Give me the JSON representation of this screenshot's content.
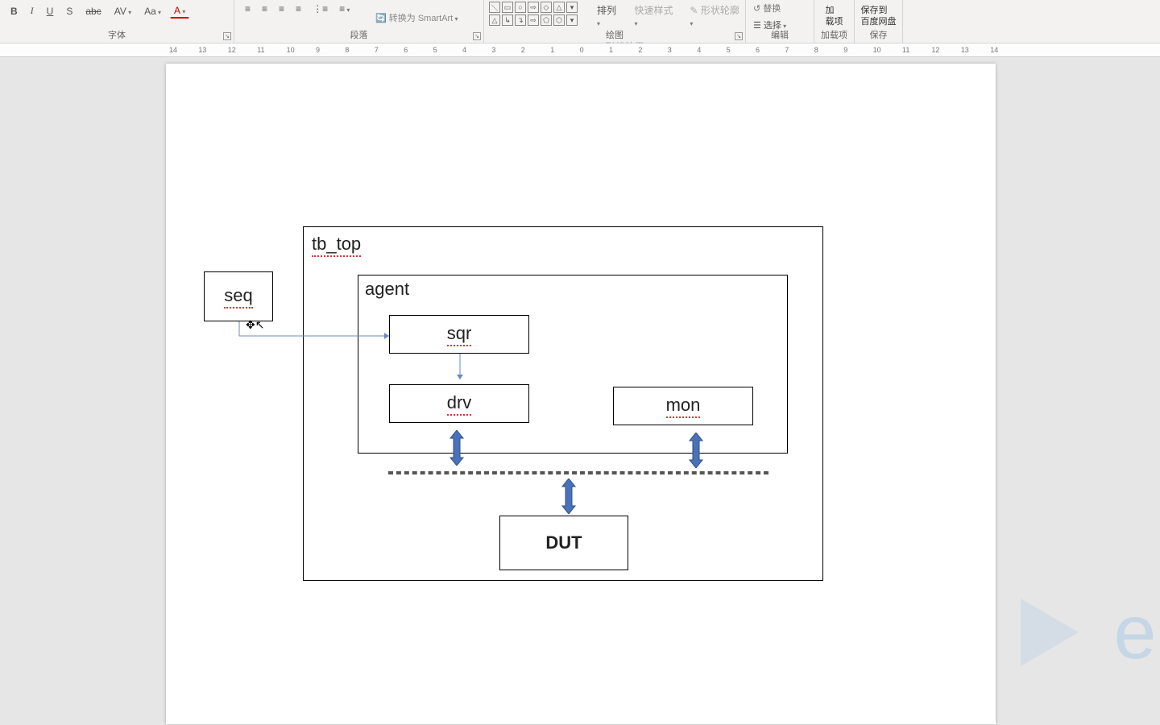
{
  "ribbon": {
    "groups": {
      "font": "字体",
      "para": "段落",
      "draw": "绘图",
      "edit": "编辑",
      "addin": "加载项",
      "save": "保存"
    },
    "font_buttons": {
      "b": "B",
      "i": "I",
      "u": "U",
      "s": "S",
      "abc": "abc",
      "av": "AV",
      "aa": "Aa",
      "fontcolor": "A"
    },
    "para_items": {
      "align_l": "≡",
      "align_c": "≡",
      "align_r": "≡",
      "align_j": "≡",
      "list": "⋮≡",
      "line": "≡",
      "smartart_btn": "转换为 SmartArt",
      "dirrow": "↕"
    },
    "draw_items": {
      "arrange": "排列",
      "quick": "快速样式",
      "outline": "形状轮廓",
      "effect": "形状效果",
      "replace": "替换",
      "select": "选择"
    },
    "edit_btn": "编辑",
    "addin_btn": "加\n载项",
    "save_btn": "保存到\n百度网盘"
  },
  "ruler": {
    "labels": [
      "14",
      "13",
      "12",
      "11",
      "10",
      "9",
      "8",
      "7",
      "6",
      "5",
      "4",
      "3",
      "2",
      "1",
      "0",
      "1",
      "2",
      "3",
      "4",
      "5",
      "6",
      "7",
      "8",
      "9",
      "10",
      "11",
      "12",
      "13",
      "14"
    ]
  },
  "diagram": {
    "seq": "seq",
    "tb_top": "tb_top",
    "agent": "agent",
    "sqr": "sqr",
    "drv": "drv",
    "mon": "mon",
    "dut": "DUT"
  },
  "watermark_text": "ev"
}
